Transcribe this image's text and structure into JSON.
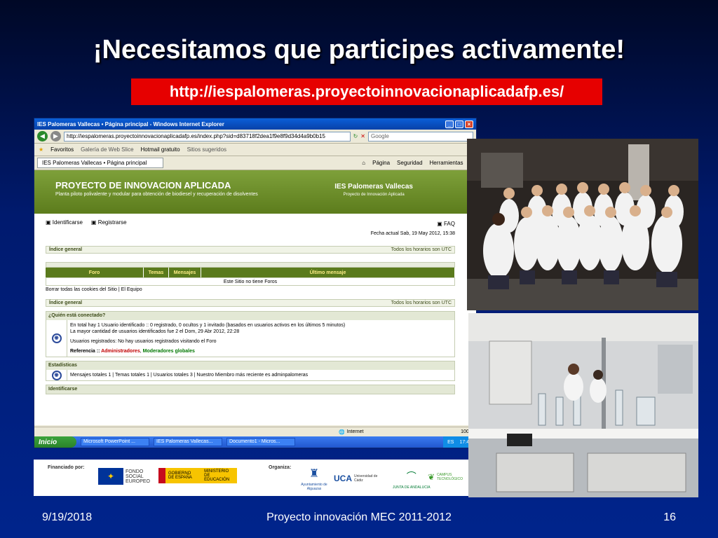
{
  "slide": {
    "title": "¡Necesitamos que participes activamente!",
    "url": "http://iespalomeras.proyectoinnovacionaplicadafp.es/",
    "footer_date": "9/19/2018",
    "footer_center": "Proyecto innovación MEC 2011-2012",
    "footer_page": "16"
  },
  "browser": {
    "window_title": "IES Palomeras Vallecas • Página principal - Windows Internet Explorer",
    "address": "http://iespalomeras.proyectoinnovacionaplicadafp.es/index.php?sid=d83718f2dea1f9e8f9d34d4a9b0b15",
    "search_placeholder": "Google",
    "favorites": [
      "Favoritos",
      "Galería de Web Slice",
      "Hotmail gratuito",
      "Sitios sugeridos"
    ],
    "tab_title": "IES Palomeras Vallecas • Página principal",
    "tab_tools": [
      "Página",
      "Seguridad",
      "Herramientas"
    ],
    "status_zone": "Internet",
    "zoom": "100%",
    "taskbar": {
      "start": "Inicio",
      "tasks": [
        "Microsoft PowerPoint ...",
        "IES Palomeras Vallecas...",
        "Documento1 - Micros..."
      ],
      "lang": "ES",
      "clock": "17:43"
    }
  },
  "forum": {
    "banner_title": "PROYECTO DE INNOVACION APLICADA",
    "banner_subtitle": "Planta piloto polivalente y modular para obtención de biodiesel y recuperación de disolventes",
    "banner_right_title": "IES Palomeras Vallecas",
    "banner_right_sub": "Proyecto de Innovación Aplicada",
    "link_login": "Identificarse",
    "link_register": "Registrarse",
    "faq": "FAQ",
    "date": "Fecha actual Sab, 19 May 2012, 15:38",
    "index_label": "Índice general",
    "timezone": "Todos los horarios son UTC",
    "columns": [
      "Foro",
      "Temas",
      "Mensajes",
      "Último mensaje"
    ],
    "no_forums": "Este Sitio no tiene Foros",
    "cookie_links": "Borrar todas las cookies del Sitio | El Equipo",
    "who_online_title": "¿Quién está conectado?",
    "who_online_line1": "En total hay 1 Usuario identificado :: 0 registrado, 0 ocultos y 1 invitado (basados en usuarios activos en los últimos 5 minutos)",
    "who_online_line2": "La mayor cantidad de usuarios identificados fue 2 el Dom, 29 Abr 2012, 22:28",
    "who_online_line3": "Usuarios registrados: No hay usuarios registrados visitando el Foro",
    "reference_label": "Referencia :: ",
    "reference_admins": "Administradores",
    "reference_mods": "Moderadores globales",
    "stats_title": "Estadísticas",
    "stats_line": "Mensajes totales 1 | Temas totales 1 | Usuarios totales 3 | Nuestro Miembro más reciente es adminpalomeras",
    "login_title": "Identificarse"
  },
  "logos": {
    "funded_by": "Financiado por:",
    "fondo": "FONDO SOCIAL EUROPEO",
    "gobierno": "GOBIERNO DE ESPAÑA",
    "ministerio": "MINISTERIO DE EDUCACIÓN",
    "organiza": "Organiza:",
    "ayto": "Ayuntamiento de Alguazas",
    "uca": "UCA",
    "uca_sub": "Universidad de Cádiz",
    "junta": "JUNTA DE ANDALUCIA",
    "campus": "CAMPUS TECNOLÓGICO"
  }
}
